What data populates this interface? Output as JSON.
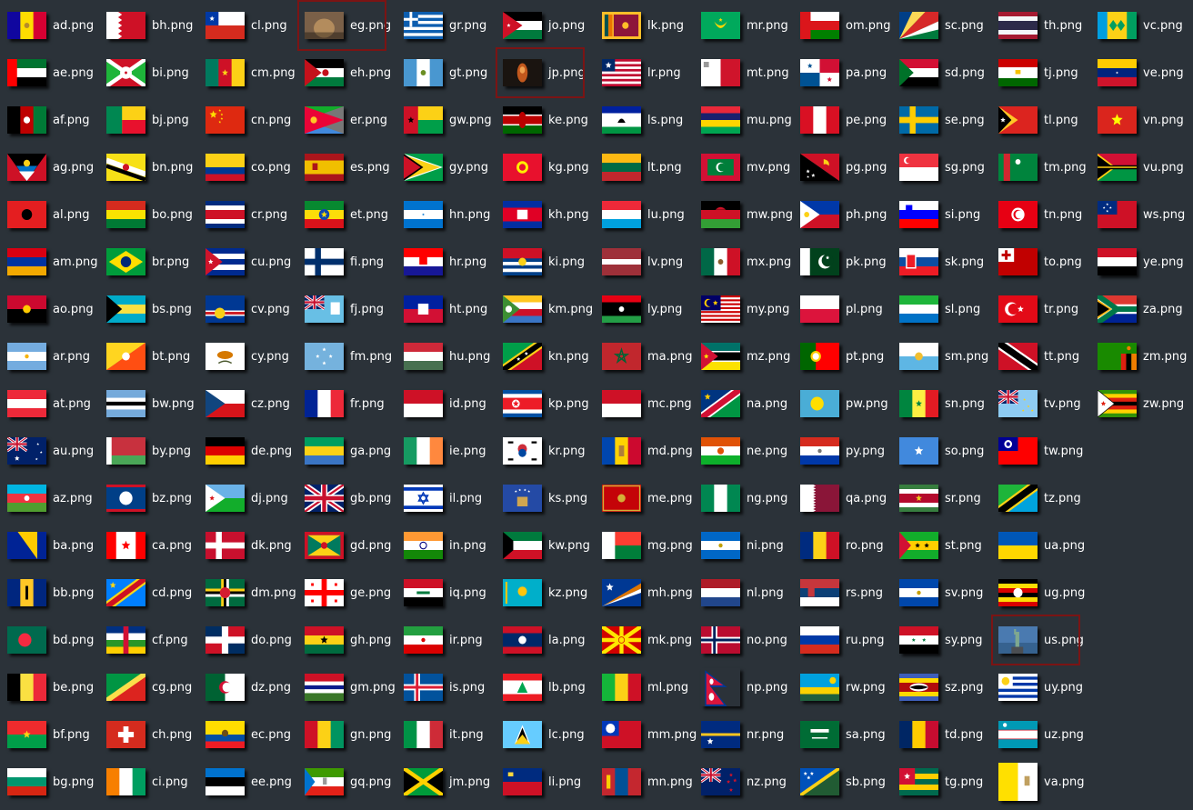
{
  "file_list": {
    "columns": [
      [
        "ad.png",
        "ae.png",
        "af.png",
        "ag.png",
        "al.png",
        "am.png",
        "ao.png",
        "ar.png",
        "at.png",
        "au.png",
        "az.png",
        "ba.png",
        "bb.png",
        "bd.png",
        "be.png",
        "bf.png",
        "bg.png"
      ],
      [
        "bh.png",
        "bi.png",
        "bj.png",
        "bn.png",
        "bo.png",
        "br.png",
        "bs.png",
        "bt.png",
        "bw.png",
        "by.png",
        "bz.png",
        "ca.png",
        "cd.png",
        "cf.png",
        "cg.png",
        "ch.png",
        "ci.png"
      ],
      [
        "cl.png",
        "cm.png",
        "cn.png",
        "co.png",
        "cr.png",
        "cu.png",
        "cv.png",
        "cy.png",
        "cz.png",
        "de.png",
        "dj.png",
        "dk.png",
        "dm.png",
        "do.png",
        "dz.png",
        "ec.png",
        "ee.png"
      ],
      [
        "eg.png",
        "eh.png",
        "er.png",
        "es.png",
        "et.png",
        "fi.png",
        "fj.png",
        "fm.png",
        "fr.png",
        "ga.png",
        "gb.png",
        "gd.png",
        "ge.png",
        "gh.png",
        "gm.png",
        "gn.png",
        "gq.png"
      ],
      [
        "gr.png",
        "gt.png",
        "gw.png",
        "gy.png",
        "hn.png",
        "hr.png",
        "ht.png",
        "hu.png",
        "id.png",
        "ie.png",
        "il.png",
        "in.png",
        "iq.png",
        "ir.png",
        "is.png",
        "it.png",
        "jm.png"
      ],
      [
        "jo.png",
        "jp.png",
        "ke.png",
        "kg.png",
        "kh.png",
        "ki.png",
        "km.png",
        "kn.png",
        "kp.png",
        "kr.png",
        "ks.png",
        "kw.png",
        "kz.png",
        "la.png",
        "lb.png",
        "lc.png",
        "li.png"
      ],
      [
        "lk.png",
        "lr.png",
        "ls.png",
        "lt.png",
        "lu.png",
        "lv.png",
        "ly.png",
        "ma.png",
        "mc.png",
        "md.png",
        "me.png",
        "mg.png",
        "mh.png",
        "mk.png",
        "ml.png",
        "mm.png",
        "mn.png"
      ],
      [
        "mr.png",
        "mt.png",
        "mu.png",
        "mv.png",
        "mw.png",
        "mx.png",
        "my.png",
        "mz.png",
        "na.png",
        "ne.png",
        "ng.png",
        "ni.png",
        "nl.png",
        "no.png",
        "np.png",
        "nr.png",
        "nz.png"
      ],
      [
        "om.png",
        "pa.png",
        "pe.png",
        "pg.png",
        "ph.png",
        "pk.png",
        "pl.png",
        "pt.png",
        "pw.png",
        "py.png",
        "qa.png",
        "ro.png",
        "rs.png",
        "ru.png",
        "rw.png",
        "sa.png",
        "sb.png"
      ],
      [
        "sc.png",
        "sd.png",
        "se.png",
        "sg.png",
        "si.png",
        "sk.png",
        "sl.png",
        "sm.png",
        "sn.png",
        "so.png",
        "sr.png",
        "st.png",
        "sv.png",
        "sy.png",
        "sz.png",
        "td.png",
        "tg.png"
      ],
      [
        "th.png",
        "tj.png",
        "tl.png",
        "tm.png",
        "tn.png",
        "to.png",
        "tr.png",
        "tt.png",
        "tv.png",
        "tw.png",
        "tz.png",
        "ua.png",
        "ug.png",
        "us.png",
        "uy.png",
        "uz.png",
        "va.png"
      ],
      [
        "vc.png",
        "ve.png",
        "vn.png",
        "vu.png",
        "ws.png",
        "ye.png",
        "za.png",
        "zm.png",
        "zw.png"
      ]
    ],
    "selected": [
      "eg.png",
      "jp.png",
      "us.png"
    ],
    "photo_thumbnails": [
      "eg.png",
      "jp.png",
      "us.png"
    ],
    "tall_thumbnails": [
      "np.png",
      "va.png"
    ],
    "colors": {
      "background": "#2b3239",
      "label": "#ffffff",
      "selection_border": "#7b1414"
    }
  }
}
